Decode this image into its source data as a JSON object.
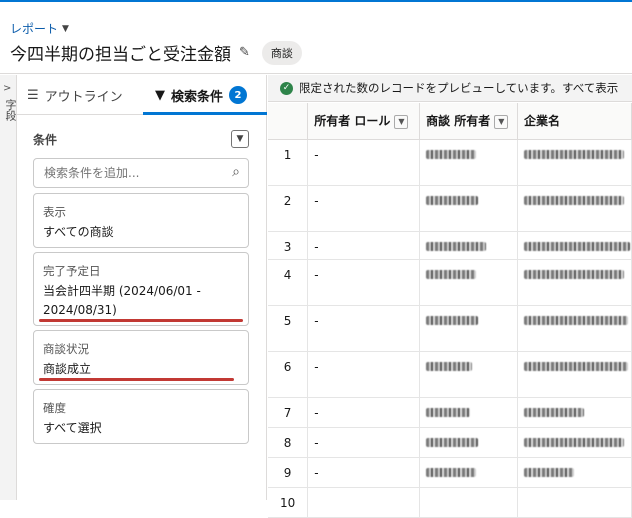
{
  "header": {
    "breadcrumb": "レポート",
    "title": "今四半期の担当ごと受注金額",
    "object_badge": "商談"
  },
  "left_strip": {
    "vertical_label": "字段"
  },
  "panel": {
    "tabs": [
      {
        "label": "アウトライン",
        "icon": "list-icon"
      },
      {
        "label": "検索条件",
        "icon": "filter-icon",
        "count": "2",
        "active": true
      }
    ],
    "conditions_label": "条件",
    "search_placeholder": "検索条件を追加...",
    "filters": [
      {
        "title": "表示",
        "value": "すべての商談"
      },
      {
        "title": "完了予定日",
        "value": "当会計四半期 (2024/06/01 - 2024/08/31)"
      },
      {
        "title": "商談状況",
        "value": "商談成立"
      },
      {
        "title": "確度",
        "value": "すべて選択"
      }
    ]
  },
  "grid": {
    "notice": "限定された数のレコードをプレビューしています。すべて表示",
    "columns": [
      "所有者 ロール",
      "商談 所有者",
      "企業名"
    ],
    "rows": [
      {
        "num": "1",
        "role": "-"
      },
      {
        "num": "2",
        "role": "-"
      },
      {
        "num": "3",
        "role": "-"
      },
      {
        "num": "4",
        "role": "-"
      },
      {
        "num": "5",
        "role": "-"
      },
      {
        "num": "6",
        "role": "-"
      },
      {
        "num": "7",
        "role": "-"
      },
      {
        "num": "8",
        "role": "-"
      },
      {
        "num": "9",
        "role": "-"
      },
      {
        "num": "10",
        "role": ""
      }
    ]
  },
  "colors": {
    "accent": "#0176d3",
    "highlight_line": "#c23934",
    "success": "#2e844a"
  }
}
